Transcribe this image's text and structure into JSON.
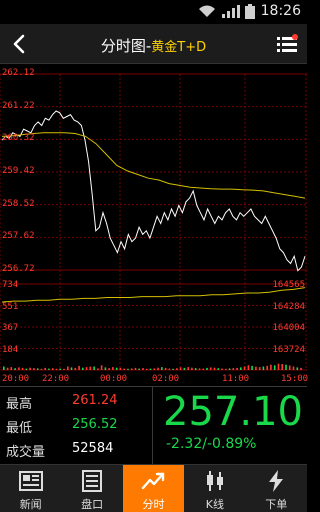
{
  "status_bar": {
    "time": "18:26"
  },
  "header": {
    "title": "分时图",
    "separator": "-",
    "instrument": "黄金T+D"
  },
  "chart_data": {
    "type": "line",
    "price_axis_labels": [
      "262.12",
      "261.22",
      "260.32",
      "259.42",
      "258.52",
      "257.62",
      "256.72"
    ],
    "volume_axis_labels": [
      "734",
      "551",
      "367",
      "184"
    ],
    "right_labels": [
      "164565",
      "164284",
      "164004",
      "163724"
    ],
    "x_labels": [
      "20:00",
      "22:00",
      "00:00",
      "02:00",
      "11:00",
      "15:00"
    ],
    "ylim": [
      256.72,
      262.12
    ],
    "series": [
      {
        "color": "#ffffff",
        "values": [
          260.3,
          260.4,
          260.35,
          260.5,
          260.45,
          260.4,
          260.6,
          260.55,
          260.5,
          260.7,
          260.8,
          260.7,
          260.9,
          260.85,
          261.0,
          261.1,
          261.05,
          260.9,
          260.95,
          261.0,
          260.85,
          260.8,
          260.7,
          260.3,
          259.7,
          258.8,
          257.8,
          257.9,
          258.3,
          258.0,
          257.6,
          257.4,
          257.2,
          257.5,
          257.3,
          257.7,
          257.5,
          257.6,
          257.9,
          257.7,
          257.8,
          257.6,
          257.9,
          258.2,
          258.0,
          258.3,
          258.1,
          258.4,
          258.2,
          258.5,
          258.3,
          258.6,
          258.7,
          258.9,
          258.5,
          258.3,
          258.1,
          258.4,
          258.2,
          258.0,
          258.2,
          258.1,
          258.3,
          258.4,
          258.2,
          258.1,
          258.3,
          258.2,
          258.3,
          258.4,
          258.2,
          258.1,
          258.0,
          258.2,
          258.0,
          257.8,
          257.6,
          257.3,
          257.2,
          257.0,
          256.9,
          257.1,
          256.7,
          256.8,
          257.1
        ],
        "name": ""
      },
      {
        "color": "#d4c000",
        "values": [
          260.4,
          260.42,
          260.45,
          260.48,
          260.5,
          260.5,
          260.5,
          260.48,
          260.4,
          260.2,
          259.9,
          259.6,
          259.45,
          259.35,
          259.25,
          259.2,
          259.1,
          259.05,
          259.0,
          258.98,
          258.96,
          258.95,
          258.95,
          258.93,
          258.92,
          258.9,
          258.85,
          258.8,
          258.75,
          258.7
        ],
        "name": ""
      }
    ],
    "volume": [
      30,
      20,
      25,
      15,
      22,
      18,
      12,
      20,
      16,
      14,
      10,
      18,
      12,
      15,
      10,
      12,
      10,
      30,
      22,
      18,
      35,
      20,
      25,
      28,
      30,
      14,
      40,
      22,
      16,
      25,
      20,
      18,
      12,
      10,
      14,
      18,
      12,
      16,
      10,
      12,
      14,
      20,
      25,
      18,
      12,
      10,
      15,
      22,
      18,
      25,
      20,
      16,
      14,
      12,
      18,
      22,
      20,
      15,
      12,
      10,
      14,
      16,
      18,
      22,
      30,
      40,
      35,
      28,
      25,
      30,
      35,
      45,
      40,
      55,
      50,
      45,
      38,
      30,
      22,
      18
    ]
  },
  "quote": {
    "high_label": "最高",
    "high_value": "261.24",
    "low_label": "最低",
    "low_value": "256.52",
    "volume_label": "成交量",
    "volume_value": "52584",
    "last_price": "257.10",
    "change": "-2.32/-0.89%",
    "colors": {
      "up": "#ff3b30",
      "down": "#19d94a"
    }
  },
  "tabs": [
    {
      "label": "新闻",
      "icon": "news-icon",
      "active": false
    },
    {
      "label": "盘口",
      "icon": "orderbook-icon",
      "active": false
    },
    {
      "label": "分时",
      "icon": "trend-icon",
      "active": true
    },
    {
      "label": "K线",
      "icon": "candlestick-icon",
      "active": false
    },
    {
      "label": "下单",
      "icon": "lightning-icon",
      "active": false
    }
  ],
  "accent_color": "#ff7a00"
}
